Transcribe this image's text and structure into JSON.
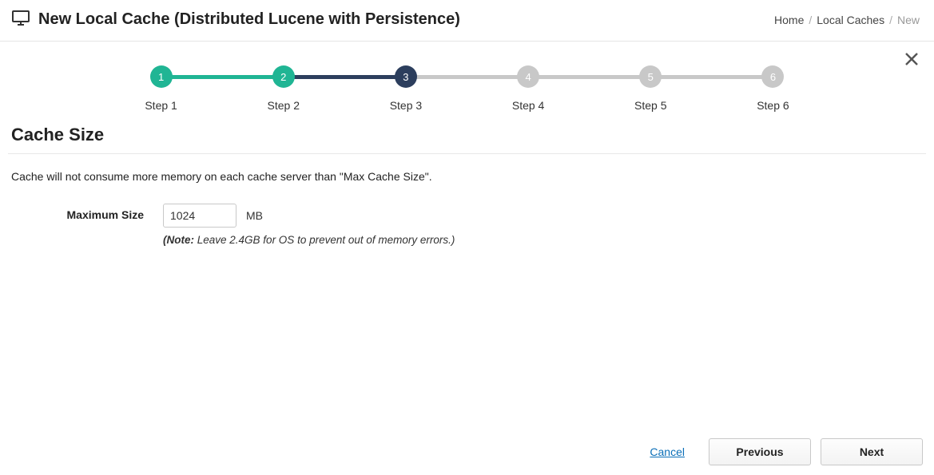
{
  "header": {
    "title": "New Local Cache (Distributed Lucene with Persistence)"
  },
  "breadcrumb": {
    "home": "Home",
    "caches": "Local Caches",
    "current": "New"
  },
  "stepper": {
    "steps": [
      {
        "num": "1",
        "label": "Step 1",
        "state": "done"
      },
      {
        "num": "2",
        "label": "Step 2",
        "state": "done"
      },
      {
        "num": "3",
        "label": "Step 3",
        "state": "active"
      },
      {
        "num": "4",
        "label": "Step 4",
        "state": "pending"
      },
      {
        "num": "5",
        "label": "Step 5",
        "state": "pending"
      },
      {
        "num": "6",
        "label": "Step 6",
        "state": "pending"
      }
    ]
  },
  "section": {
    "title": "Cache Size",
    "description": "Cache will not consume more memory on each cache server than \"Max Cache Size\"."
  },
  "form": {
    "maxSize": {
      "label": "Maximum Size",
      "value": "1024",
      "unit": "MB",
      "notePrefix": "(Note:",
      "noteText": " Leave 2.4GB for OS to prevent out of memory errors.)"
    }
  },
  "footer": {
    "cancel": "Cancel",
    "previous": "Previous",
    "next": "Next"
  }
}
